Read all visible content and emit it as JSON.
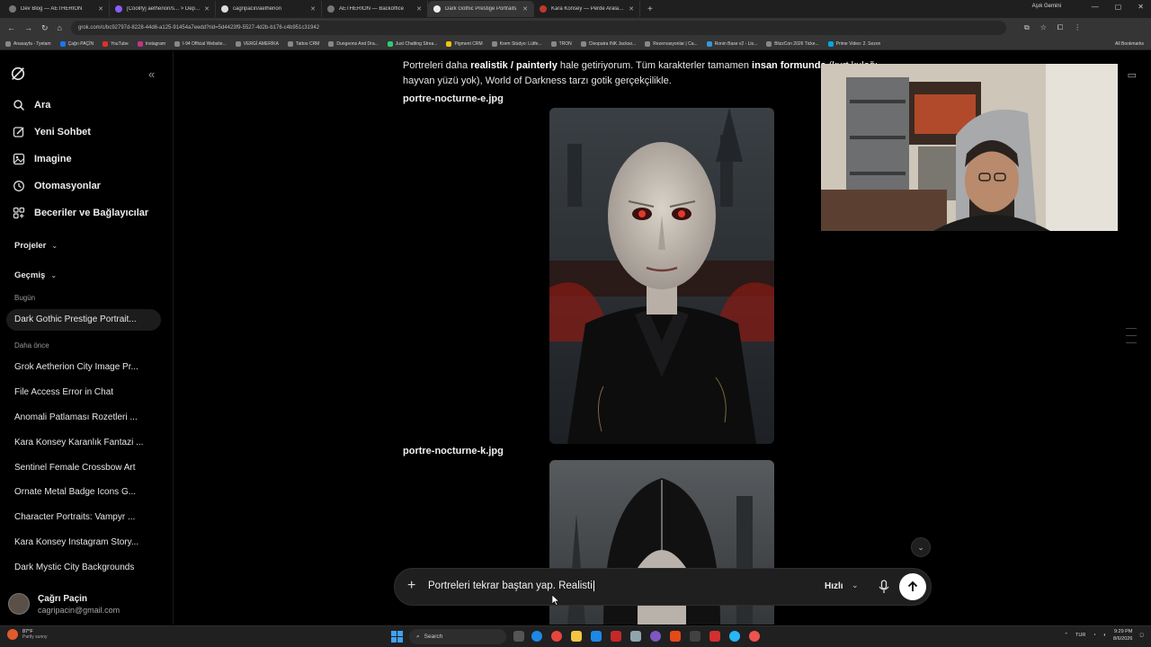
{
  "browser": {
    "tabs": [
      {
        "title": "Dev Blog — AETHERION",
        "active": false
      },
      {
        "title": "[Coolify] aetherion/s... > Deploy",
        "active": false
      },
      {
        "title": "cagripacin/aetherion",
        "active": false
      },
      {
        "title": "AETHERION — Backoffice",
        "active": false
      },
      {
        "title": "Dark Gothic Prestige Portraits",
        "active": true
      },
      {
        "title": "Kara Konsey — Perde Aralanıyor",
        "active": false
      }
    ],
    "profile": "Aşık Gemini",
    "url": "grok.com/c/bc92797d-8228-44d6-a125-91454a7eedd?rid=5d4423f9-5527-4d2b-b176-c4b951c31942",
    "bookmarks": [
      "Anasayfa - Tyetam",
      "Çağrı PAÇİN",
      "YouTube",
      "Instagram",
      "I-94 Official Website...",
      "VERGİ AMERİKA",
      "Tattoo CRM",
      "Dungeons And Dra...",
      "Just Chatting Strea...",
      "Pigment CRM",
      "Krem Stüdyo: Lütfe...",
      "TRON",
      "Cleopatra INK Jackso...",
      "Rezervasyonlar | Ca...",
      "Ronin Base v2 - Lis...",
      "BlizzCon 2026 Ticke...",
      "Prime Video: 2. Sezon"
    ],
    "all_bookmarks": "All Bookmarks"
  },
  "sidebar": {
    "collapse_glyph": "«",
    "menu": [
      {
        "label": "Ara",
        "icon": "search-icon"
      },
      {
        "label": "Yeni Sohbet",
        "icon": "edit-icon"
      },
      {
        "label": "Imagine",
        "icon": "image-icon"
      },
      {
        "label": "Otomasyonlar",
        "icon": "clock-icon"
      },
      {
        "label": "Beceriler ve Bağlayıcılar",
        "icon": "connectors-icon"
      }
    ],
    "projects_label": "Projeler",
    "history_label": "Geçmiş",
    "today_label": "Bugün",
    "today_items": [
      "Dark Gothic Prestige Portrait..."
    ],
    "earlier_label": "Daha önce",
    "earlier_items": [
      "Grok Aetherion City Image Pr...",
      "File Access Error in Chat",
      "Anomali Patlaması Rozetleri ...",
      "Kara Konsey Karanlık Fantazi ...",
      "Sentinel Female Crossbow Art",
      "Ornate Metal Badge Icons G...",
      "Character Portraits: Vampyr ...",
      "Kara Konsey Instagram Story...",
      "Dark Mystic City Backgrounds"
    ],
    "user": {
      "name": "Çağrı Paçin",
      "email": "cagripacin@gmail.com"
    }
  },
  "main": {
    "intro_parts": {
      "p1": "Portreleri daha ",
      "b1": "realistik / painterly",
      "p2": " hale getiriyorum. Tüm karakterler tamamen ",
      "b2": "insan formunda",
      "p3": " (kurt kulağı, hayvan yüzü yok), World of Darkness tarzı gotik gerçekçilikle."
    },
    "images": [
      {
        "filename": "portre-nocturne-e.jpg"
      },
      {
        "filename": "portre-nocturne-k.jpg"
      }
    ]
  },
  "composer": {
    "text": "Portreleri tekrar baştan yap. Realisti",
    "mode": "Hızlı"
  },
  "taskbar": {
    "temp": "87°F",
    "weather": "Partly sunny",
    "search": "Search",
    "lang": "TUR",
    "time": "9:29 PM",
    "date": "8/6/2026"
  },
  "colors": {
    "accent": "#ffffff",
    "bg": "#000000",
    "blood": "#8a1a12"
  }
}
